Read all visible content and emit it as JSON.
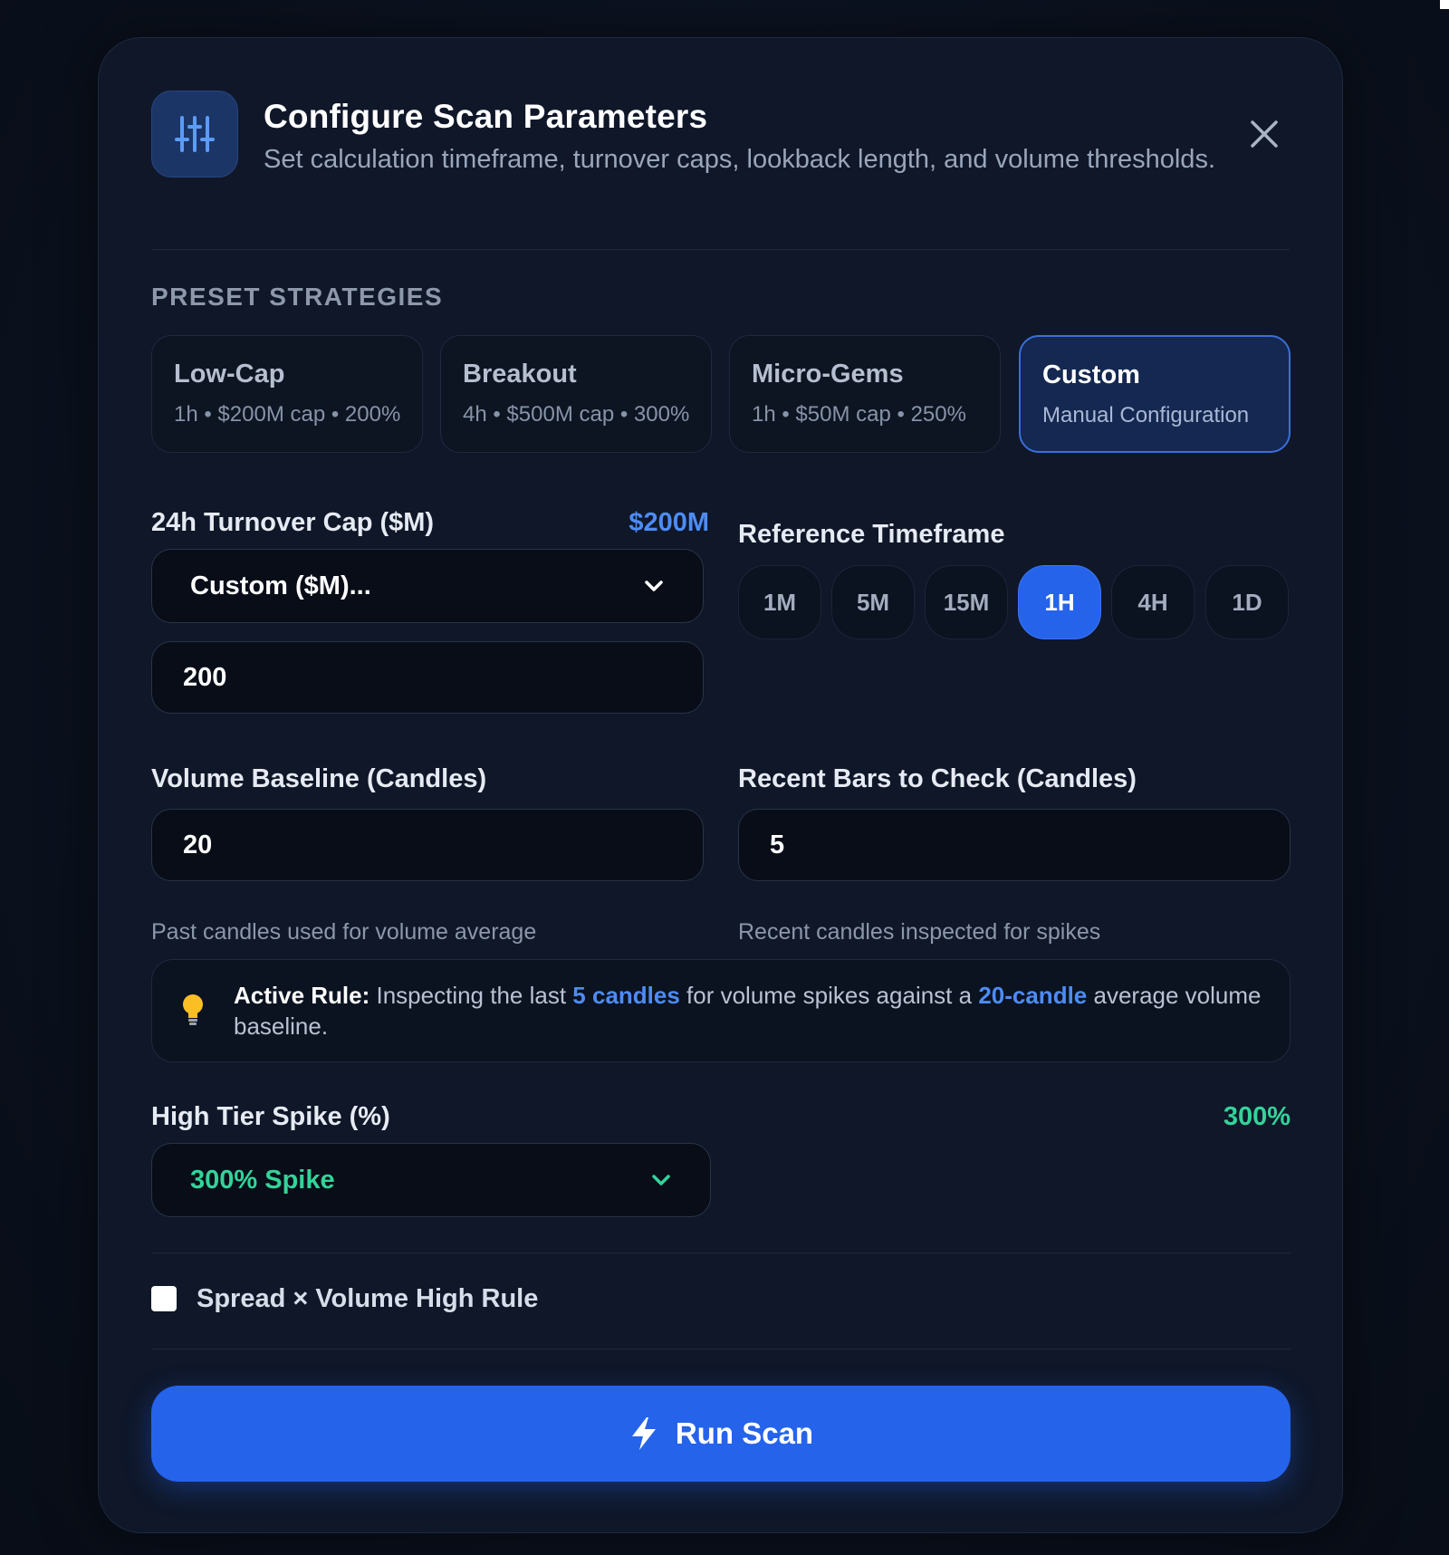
{
  "header": {
    "title": "Configure Scan Parameters",
    "subtitle": "Set calculation timeframe, turnover caps, lookback length, and volume thresholds.",
    "icon": "sliders-icon",
    "close_icon": "close-icon"
  },
  "presets": {
    "section_label": "PRESET STRATEGIES",
    "items": [
      {
        "name": "Low-Cap",
        "desc": "1h • $200M cap • 200%",
        "active": false
      },
      {
        "name": "Breakout",
        "desc": "4h • $500M cap • 300%",
        "active": false
      },
      {
        "name": "Micro-Gems",
        "desc": "1h • $50M cap • 250%",
        "active": false
      },
      {
        "name": "Custom",
        "desc": "Manual Configuration",
        "active": true
      }
    ]
  },
  "turnover": {
    "label": "24h Turnover Cap ($M)",
    "value_tag": "$200M",
    "select_value": "Custom ($M)...",
    "input_value": "200"
  },
  "timeframe": {
    "label": "Reference Timeframe",
    "options": [
      "1M",
      "5M",
      "15M",
      "1H",
      "4H",
      "1D"
    ],
    "selected": "1H"
  },
  "baseline": {
    "label": "Volume Baseline (Candles)",
    "value": "20",
    "hint": "Past candles used for volume average"
  },
  "recent": {
    "label": "Recent Bars to Check (Candles)",
    "value": "5",
    "hint": "Recent candles inspected for spikes"
  },
  "rule": {
    "icon": "lightbulb-icon",
    "prefix": "Active Rule:",
    "text1": " Inspecting the last ",
    "hl1": "5 candles",
    "text2": " for volume spikes against a ",
    "hl2": "20-candle",
    "text3": " average volume baseline."
  },
  "spike": {
    "label": "High Tier Spike (%)",
    "value_tag": "300%",
    "select_value": "300% Spike"
  },
  "spread_rule": {
    "label": "Spread × Volume High Rule",
    "checked": false
  },
  "run": {
    "label": "Run Scan",
    "icon": "lightning-icon"
  },
  "colors": {
    "accent": "#2563eb",
    "link_blue": "#4d8cf5",
    "green": "#34d399",
    "background": "#0f1729"
  }
}
